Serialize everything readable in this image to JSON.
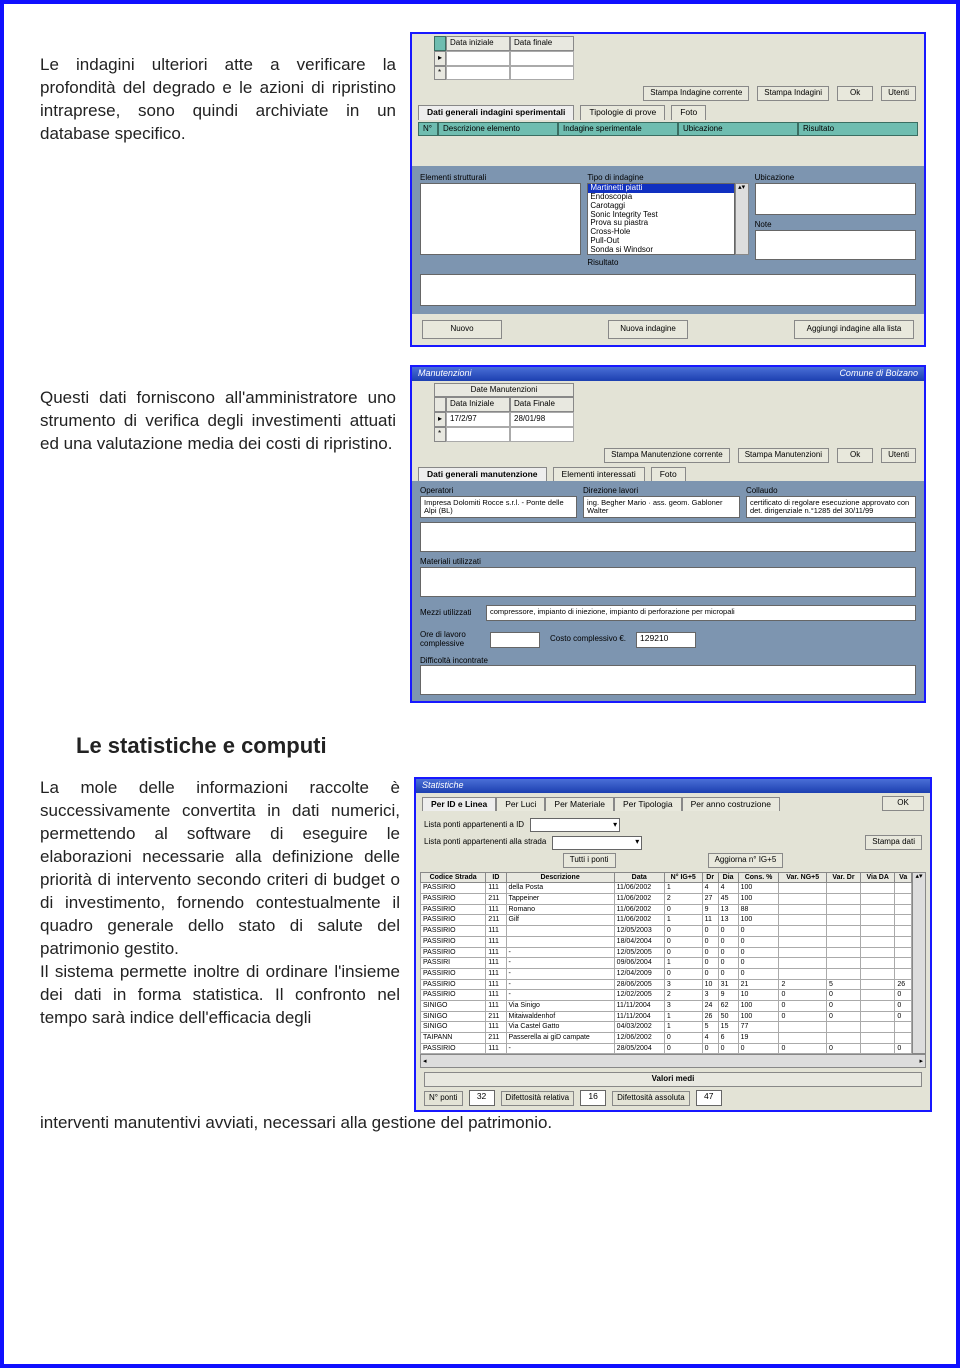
{
  "para1": "Le indagini ulteriori atte a verificare la profondità del degrado e le azioni di ripristino intraprese, sono quindi archiviate in un database specifico.",
  "para2": "Questi dati forniscono all'amministratore uno strumento di verifica degli investimenti attuati ed una valutazione media dei costi di ripristino.",
  "h_stats": "Le statistiche e computi",
  "para3": "La mole delle informazioni raccolte è successivamente convertita in dati numerici, permettendo al software di eseguire le elaborazioni necessarie alla definizione delle priorità di intervento secondo criteri di budget o di investimento, fornendo contestualmente il quadro generale dello stato di salute del patrimonio gestito.",
  "para4a": "Il sistema permette inoltre di ordinare l'insieme dei dati in forma statistica. Il confronto nel tempo sarà indice dell'efficacia degli",
  "para4b": "interventi manutentivi avviati, necessari alla gestione del patrimonio.",
  "win1": {
    "date_cols": [
      "Data iniziale",
      "Data finale"
    ],
    "btns": {
      "stampa_corr": "Stampa Indagine corrente",
      "stampa_ind": "Stampa Indagini",
      "ok": "Ok",
      "utenti": "Utenti"
    },
    "tabs": {
      "dati": "Dati generali indagini sperimentali",
      "tip": "Tipologie di prove",
      "foto": "Foto"
    },
    "row_hdr": [
      "N°",
      "Descrizione elemento",
      "Indagine sperimentale",
      "Ubicazione",
      "Risultato"
    ],
    "sec": {
      "elem": "Elementi strutturali",
      "tipo": "Tipo di indagine",
      "ubic": "Ubicazione",
      "note": "Note",
      "ris": "Risultato"
    },
    "list": [
      "Martinetti piatti",
      "Endoscopia",
      "Carotaggi",
      "Sonic Integrity Test",
      "Prova su piastra",
      "Cross-Hole",
      "Pull-Out",
      "Sonda si Windsor"
    ],
    "bottom": {
      "nuovo": "Nuovo",
      "nuova_ind": "Nuova indagine",
      "aggiungi": "Aggiungi indagine alla lista"
    }
  },
  "win2": {
    "title_l": "Manutenzioni",
    "title_r": "Comune di Bolzano",
    "date_hdr": "Date Manutenzioni",
    "date_cols": [
      "Data Iniziale",
      "Data Finale"
    ],
    "date_row": [
      "17/2/97",
      "28/01/98"
    ],
    "btns": {
      "stampa_corr": "Stampa Manutenzione corrente",
      "stampa_man": "Stampa Manutenzioni",
      "ok": "Ok",
      "utenti": "Utenti"
    },
    "tabs": {
      "dati": "Dati generali manutenzione",
      "elem": "Elementi interessati",
      "foto": "Foto"
    },
    "fields": {
      "operatori": {
        "label": "Operatori",
        "value": "Impresa Dolomiti Rocce s.r.l. - Ponte delle Alpi (BL)"
      },
      "direzione": {
        "label": "Direzione lavori",
        "value": "ing. Begher Mario · ass. geom. Gabloner Walter"
      },
      "collaudo": {
        "label": "Collaudo",
        "value": "certificato di regolare esecuzione approvato con det. dirigenziale n.°1285 del 30/11/99"
      },
      "materiali": {
        "label": "Materiali utilizzati"
      },
      "mezzi": {
        "label": "Mezzi utilizzati",
        "value": "compressore, impianto di iniezione, impianto di perforazione per micropali"
      },
      "ore": {
        "label": "Ore di lavoro complessive"
      },
      "costo": {
        "label": "Costo complessivo €.",
        "value": "129210"
      },
      "diff": {
        "label": "Difficoltà incontrate"
      }
    }
  },
  "win3": {
    "title": "Statistiche",
    "ok": "OK",
    "tabs": [
      "Per ID e Linea",
      "Per Luci",
      "Per Materiale",
      "Per Tipologia",
      "Per anno costruzione"
    ],
    "l1": "Lista ponti appartenenti a ID",
    "l2": "Lista ponti appartenenti alla strada",
    "btns": {
      "stampa": "Stampa dati",
      "tutti": "Tutti i ponti",
      "aggiorna": "Aggiorna n° IG+5"
    },
    "cols": [
      "Codice Strada",
      "ID",
      "Descrizione",
      "Data",
      "N° IG+5",
      "Dr",
      "Dia",
      "Cons. %",
      "Var. NG+5",
      "Var. Dr",
      "Via DA",
      "Va"
    ],
    "rows": [
      [
        "PASSIRIO",
        "111",
        "della Posta",
        "11/06/2002",
        "1",
        "4",
        "4",
        "100",
        "",
        "",
        "",
        ""
      ],
      [
        "PASSIRIO",
        "211",
        "Tappeiner",
        "11/06/2002",
        "2",
        "27",
        "45",
        "100",
        "",
        "",
        "",
        ""
      ],
      [
        "PASSIRIO",
        "111",
        "Romano",
        "11/06/2002",
        "0",
        "9",
        "13",
        "88",
        "",
        "",
        "",
        ""
      ],
      [
        "PASSIRIO",
        "211",
        "Gilf",
        "11/06/2002",
        "1",
        "11",
        "13",
        "100",
        "",
        "",
        "",
        ""
      ],
      [
        "PASSIRIO",
        "111",
        "",
        "12/05/2003",
        "0",
        "0",
        "0",
        "0",
        "",
        "",
        "",
        ""
      ],
      [
        "PASSIRIO",
        "111",
        "",
        "18/04/2004",
        "0",
        "0",
        "0",
        "0",
        "",
        "",
        "",
        ""
      ],
      [
        "PASSIRIO",
        "111",
        "-",
        "12/05/2005",
        "0",
        "0",
        "0",
        "0",
        "",
        "",
        "",
        ""
      ],
      [
        "PASSIRI",
        "111",
        "-",
        "09/06/2004",
        "1",
        "0",
        "0",
        "0",
        "",
        "",
        "",
        ""
      ],
      [
        "PASSIRIO",
        "111",
        "-",
        "12/04/2009",
        "0",
        "0",
        "0",
        "0",
        "",
        "",
        "",
        ""
      ],
      [
        "PASSIRIO",
        "111",
        "-",
        "28/06/2005",
        "3",
        "10",
        "31",
        "21",
        "2",
        "5",
        "",
        "26"
      ],
      [
        "PASSIRIO",
        "111",
        "-",
        "12/02/2005",
        "2",
        "3",
        "9",
        "10",
        "0",
        "0",
        "",
        "0"
      ],
      [
        "SINIGO",
        "111",
        "Via Sinigo",
        "11/11/2004",
        "3",
        "24",
        "62",
        "100",
        "0",
        "0",
        "",
        "0"
      ],
      [
        "SINIGO",
        "211",
        "Mitaiwaldenhof",
        "11/11/2004",
        "1",
        "26",
        "50",
        "100",
        "0",
        "0",
        "",
        "0"
      ],
      [
        "SINIGO",
        "111",
        "Via Castel Gatto",
        "04/03/2002",
        "1",
        "5",
        "15",
        "77",
        "",
        "",
        "",
        ""
      ],
      [
        "TAIPANN",
        "211",
        "Passerella ai giD campate",
        "12/06/2002",
        "0",
        "4",
        "6",
        "19",
        "",
        "",
        "",
        ""
      ],
      [
        "PASSIRIO",
        "111",
        "-",
        "28/05/2004",
        "0",
        "0",
        "0",
        "0",
        "0",
        "0",
        "",
        "0"
      ]
    ],
    "footer": {
      "valori": "Valori medi",
      "np_lbl": "N° ponti",
      "np": "32",
      "dr_lbl": "Difettosità relativa",
      "dr": "16",
      "da_lbl": "Difettosità assoluta",
      "da": "47"
    }
  }
}
